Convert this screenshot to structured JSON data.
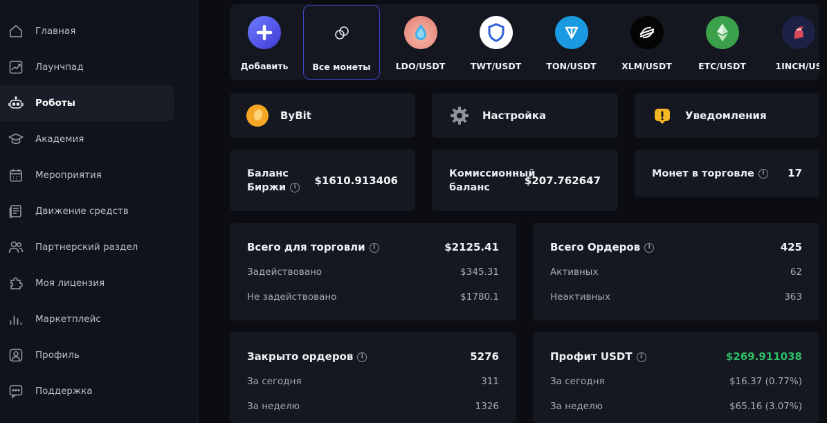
{
  "sidebar": {
    "items": [
      {
        "label": "Главная",
        "icon": "home-icon"
      },
      {
        "label": "Лаунчпад",
        "icon": "chart-icon"
      },
      {
        "label": "Роботы",
        "icon": "robot-icon"
      },
      {
        "label": "Академия",
        "icon": "academy-cap-icon"
      },
      {
        "label": "Мероприятия",
        "icon": "calendar-icon"
      },
      {
        "label": "Движение средств",
        "icon": "ledger-icon"
      },
      {
        "label": "Партнерский раздел",
        "icon": "partners-icon"
      },
      {
        "label": "Моя лицензия",
        "icon": "puzzle-icon"
      },
      {
        "label": "Маркетплейс",
        "icon": "bars-icon"
      },
      {
        "label": "Профиль",
        "icon": "profile-icon"
      },
      {
        "label": "Поддержка",
        "icon": "chat-icon"
      }
    ],
    "active": "Роботы"
  },
  "coins": [
    {
      "label": "Добавить",
      "icon": "plus-icon"
    },
    {
      "label": "Все монеты",
      "icon": "coins-icon",
      "selected": true
    },
    {
      "label": "LDO/USDT",
      "icon": "ldo-icon"
    },
    {
      "label": "TWT/USDT",
      "icon": "twt-shield-icon"
    },
    {
      "label": "TON/USDT",
      "icon": "ton-icon"
    },
    {
      "label": "XLM/USDT",
      "icon": "xlm-icon"
    },
    {
      "label": "ETC/USDT",
      "icon": "etc-icon"
    },
    {
      "label": "1INCH/US",
      "icon": "1inch-icon"
    }
  ],
  "exchange": {
    "label": "ByBit"
  },
  "settings": {
    "label": "Настройка"
  },
  "notifications": {
    "label": "Уведомления"
  },
  "balances": {
    "exchange_label_1": "Баланс",
    "exchange_label_2": "Биржи",
    "exchange_value": "$1610.913406",
    "commission_label_1": "Комиссионный",
    "commission_label_2": "баланс",
    "commission_value": "$207.762647",
    "coins_trading_label": "Монет в торговле",
    "coins_trading_value": "17"
  },
  "stats": {
    "trading": {
      "title": "Всего для торговли",
      "total": "$2125.41",
      "rows": [
        {
          "label": "Задействовано",
          "value": "$345.31"
        },
        {
          "label": "Не задействовано",
          "value": "$1780.1"
        }
      ]
    },
    "orders": {
      "title": "Всего Ордеров",
      "total": "425",
      "rows": [
        {
          "label": "Активных",
          "value": "62"
        },
        {
          "label": "Неактивных",
          "value": "363"
        }
      ]
    },
    "closed": {
      "title": "Закрыто ордеров",
      "total": "5276",
      "rows": [
        {
          "label": "За сегодня",
          "value": "311"
        },
        {
          "label": "За неделю",
          "value": "1326"
        }
      ]
    },
    "profit": {
      "title": "Профит USDT",
      "total": "$269.911038",
      "rows": [
        {
          "label": "За сегодня",
          "value": "$16.37 (0.77%)"
        },
        {
          "label": "За неделю",
          "value": "$65.16 (3.07%)"
        }
      ]
    }
  },
  "colors": {
    "background": "#0b0d13",
    "sidebar": "#10131b",
    "card": "#151821",
    "accent_border": "#3d47c9",
    "profit_green": "#2fbf68"
  }
}
